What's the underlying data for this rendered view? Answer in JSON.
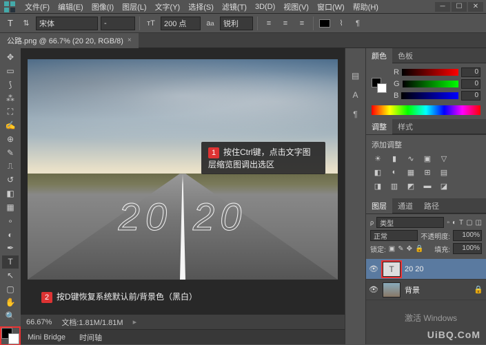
{
  "menu": {
    "items": [
      "文件(F)",
      "编辑(E)",
      "图像(I)",
      "图层(L)",
      "文字(Y)",
      "选择(S)",
      "滤镜(T)",
      "3D(D)",
      "视图(V)",
      "窗口(W)",
      "帮助(H)"
    ]
  },
  "optbar": {
    "font_family": "宋体",
    "font_style": "-",
    "size": "200 点",
    "aa": "锐利"
  },
  "doc_tab": {
    "label": "公路.png @ 66.7% (20 20, RGB/8)",
    "close": "×"
  },
  "callouts": {
    "c1_num": "1",
    "c1_text": "按住Ctrl键，点击文字图层缩览图调出选区",
    "c2_num": "2",
    "c2_text": "按D键恢复系统默认前/背景色（黑白）"
  },
  "canvas_text": {
    "left": "20",
    "right": "20"
  },
  "status": {
    "zoom": "66.67%",
    "docinfo": "文档:1.81M/1.81M"
  },
  "bottom_tabs": {
    "a": "Mini Bridge",
    "b": "时间轴"
  },
  "color_panel": {
    "tab_color": "颜色",
    "tab_swatch": "色板",
    "r": "R",
    "g": "G",
    "b": "B",
    "rv": "0",
    "gv": "0",
    "bv": "0"
  },
  "adjust_panel": {
    "tab_adjust": "调整",
    "tab_style": "样式",
    "title": "添加调整"
  },
  "layers_panel": {
    "tab_layers": "图层",
    "tab_channels": "通道",
    "tab_paths": "路径",
    "kind": "类型",
    "blend": "正常",
    "opacity_label": "不透明度:",
    "opacity": "100%",
    "lock_label": "锁定:",
    "fill_label": "填充:",
    "fill": "100%",
    "layers": [
      {
        "name": "20 20",
        "thumb": "T"
      },
      {
        "name": "背景",
        "thumb": ""
      }
    ]
  },
  "watermark": {
    "line1": "激活 Windows",
    "brand": "UiBQ.CoM"
  }
}
